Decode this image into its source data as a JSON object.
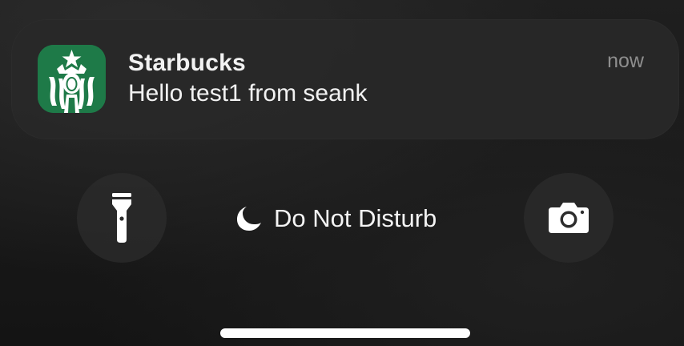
{
  "notification": {
    "app_name": "Starbucks",
    "message": "Hello test1 from seank",
    "time": "now",
    "icon": "starbucks-logo",
    "icon_color": "#1e7a48"
  },
  "quick_actions": {
    "left_icon": "flashlight-icon",
    "right_icon": "camera-icon",
    "focus_icon": "moon-icon",
    "focus_label": "Do Not Disturb"
  }
}
